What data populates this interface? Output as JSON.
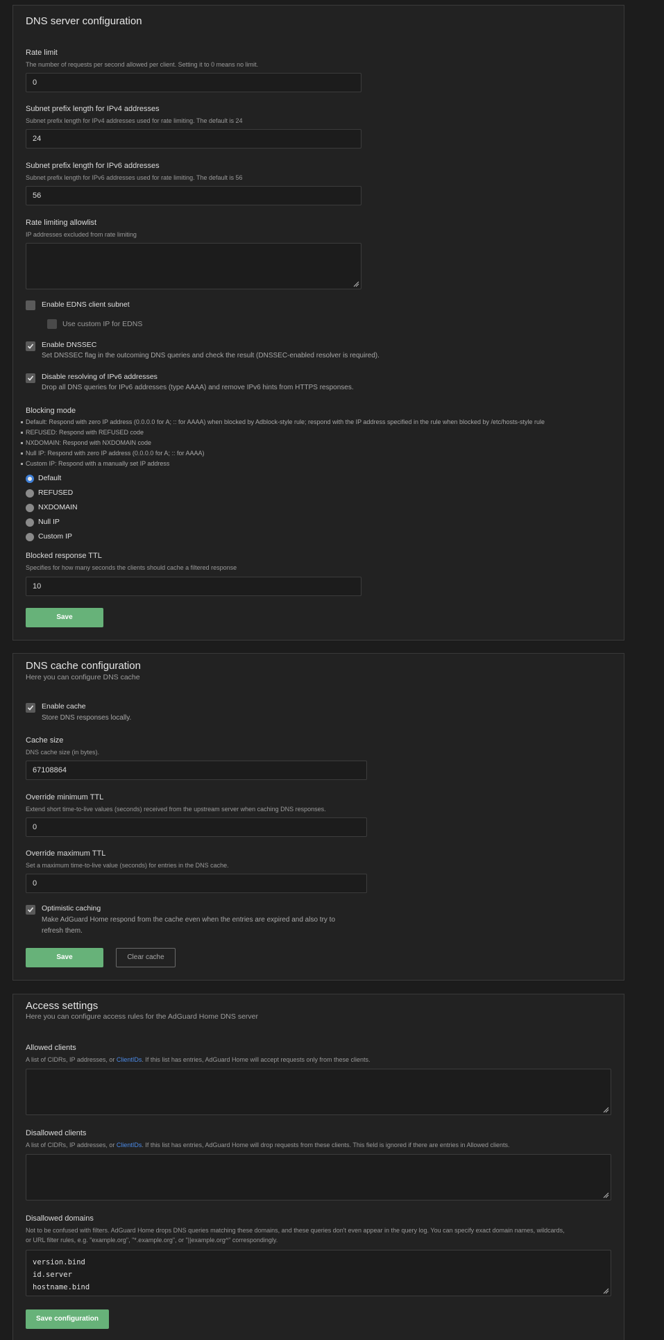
{
  "dns_server": {
    "title": "DNS server configuration",
    "rate_limit": {
      "label": "Rate limit",
      "help": "The number of requests per second allowed per client. Setting it to 0 means no limit.",
      "value": "0"
    },
    "subnet_v4": {
      "label": "Subnet prefix length for IPv4 addresses",
      "help": "Subnet prefix length for IPv4 addresses used for rate limiting. The default is 24",
      "value": "24"
    },
    "subnet_v6": {
      "label": "Subnet prefix length for IPv6 addresses",
      "help": "Subnet prefix length for IPv6 addresses used for rate limiting. The default is 56",
      "value": "56"
    },
    "allowlist": {
      "label": "Rate limiting allowlist",
      "help": "IP addresses excluded from rate limiting",
      "value": ""
    },
    "edns": {
      "label": "Enable EDNS client subnet",
      "checked": false
    },
    "custom_ip_edns": {
      "label": "Use custom IP for EDNS",
      "checked": false
    },
    "dnssec": {
      "label": "Enable DNSSEC",
      "desc": "Set DNSSEC flag in the outcoming DNS queries and check the result (DNSSEC-enabled resolver is required).",
      "checked": true
    },
    "disable_ipv6": {
      "label": "Disable resolving of IPv6 addresses",
      "desc": "Drop all DNS queries for IPv6 addresses (type AAAA) and remove IPv6 hints from HTTPS responses.",
      "checked": true
    },
    "blocking_mode": {
      "label": "Blocking mode",
      "bullets": [
        "Default: Respond with zero IP address (0.0.0.0 for A; :: for AAAA) when blocked by Adblock-style rule; respond with the IP address specified in the rule when blocked by /etc/hosts-style rule",
        "REFUSED: Respond with REFUSED code",
        "NXDOMAIN: Respond with NXDOMAIN code",
        "Null IP: Respond with zero IP address (0.0.0.0 for A; :: for AAAA)",
        "Custom IP: Respond with a manually set IP address"
      ],
      "options": [
        "Default",
        "REFUSED",
        "NXDOMAIN",
        "Null IP",
        "Custom IP"
      ],
      "selected": "Default"
    },
    "blocked_ttl": {
      "label": "Blocked response TTL",
      "help": "Specifies for how many seconds the clients should cache a filtered response",
      "value": "10"
    },
    "save_label": "Save"
  },
  "dns_cache": {
    "title": "DNS cache configuration",
    "subtitle": "Here you can configure DNS cache",
    "enable_cache": {
      "label": "Enable cache",
      "desc": "Store DNS responses locally.",
      "checked": true
    },
    "cache_size": {
      "label": "Cache size",
      "help": "DNS cache size (in bytes).",
      "value": "67108864"
    },
    "min_ttl": {
      "label": "Override minimum TTL",
      "help": "Extend short time-to-live values (seconds) received from the upstream server when caching DNS responses.",
      "value": "0"
    },
    "max_ttl": {
      "label": "Override maximum TTL",
      "help": "Set a maximum time-to-live value (seconds) for entries in the DNS cache.",
      "value": "0"
    },
    "optimistic": {
      "label": "Optimistic caching",
      "desc_line1": "Make AdGuard Home respond from the cache even when the entries are expired and also try to",
      "desc_line2": "refresh them.",
      "checked": true
    },
    "save_label": "Save",
    "clear_label": "Clear cache"
  },
  "access": {
    "title": "Access settings",
    "subtitle": "Here you can configure access rules for the AdGuard Home DNS server",
    "allowed": {
      "label": "Allowed clients",
      "help_pre": "A list of CIDRs, IP addresses, or ",
      "help_link": "ClientIDs",
      "help_post": ". If this list has entries, AdGuard Home will accept requests only from these clients.",
      "value": ""
    },
    "disallowed": {
      "label": "Disallowed clients",
      "help_pre": "A list of CIDRs, IP addresses, or ",
      "help_link": "ClientIDs",
      "help_post": ". If this list has entries, AdGuard Home will drop requests from these clients. This field is ignored if there are entries in Allowed clients.",
      "value": ""
    },
    "domains": {
      "label": "Disallowed domains",
      "help_line1": "Not to be confused with filters. AdGuard Home drops DNS queries matching these domains, and these queries don't even appear in the query log. You can specify exact domain names, wildcards,",
      "help_line2": "or URL filter rules, e.g. \"example.org\", \"*.example.org\", or \"||example.org^\" correspondingly.",
      "lines": [
        "version.bind",
        "id.server",
        "hostname.bind"
      ]
    },
    "save_label": "Save configuration"
  },
  "colors": {
    "accent_green": "#67b279",
    "radio_blue": "#3f7fd6",
    "link_blue": "#4b8ae6",
    "background": "#1c1c1c"
  }
}
